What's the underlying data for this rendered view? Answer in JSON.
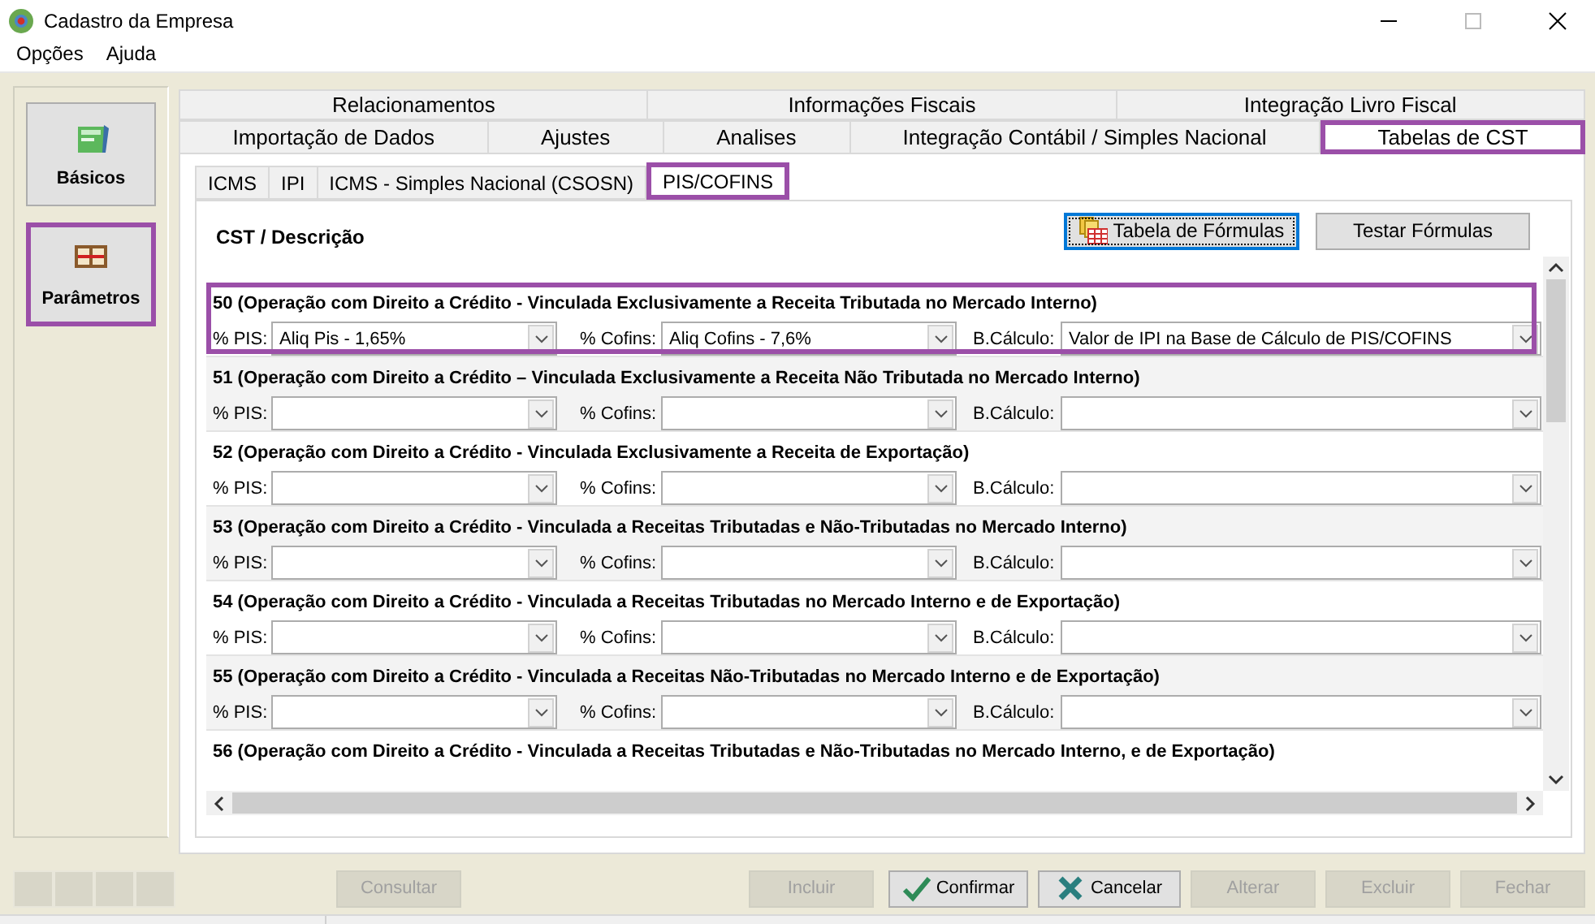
{
  "window": {
    "title": "Cadastro da Empresa"
  },
  "menu": [
    {
      "label": "Opções"
    },
    {
      "label": "Ajuda"
    }
  ],
  "sidebar": {
    "items": [
      {
        "label": "Básicos",
        "highlighted": false
      },
      {
        "label": "Parâmetros",
        "highlighted": true
      }
    ]
  },
  "tab_rows": [
    [
      {
        "label": "Relacionamentos",
        "selected": false,
        "highlighted": false
      },
      {
        "label": "Informações Fiscais",
        "selected": false,
        "highlighted": false
      },
      {
        "label": "Integração Livro Fiscal",
        "selected": false,
        "highlighted": false
      }
    ],
    [
      {
        "label": "Importação de Dados",
        "selected": false,
        "highlighted": false
      },
      {
        "label": "Ajustes",
        "selected": false,
        "highlighted": false
      },
      {
        "label": "Analises",
        "selected": false,
        "highlighted": false
      },
      {
        "label": "Integração Contábil / Simples Nacional",
        "selected": false,
        "highlighted": false
      },
      {
        "label": "Tabelas de CST",
        "selected": true,
        "highlighted": true
      }
    ]
  ],
  "subtabs": [
    {
      "label": "ICMS",
      "selected": false,
      "highlighted": false
    },
    {
      "label": "IPI",
      "selected": false,
      "highlighted": false
    },
    {
      "label": "ICMS - Simples Nacional (CSOSN)",
      "selected": false,
      "highlighted": false
    },
    {
      "label": "PIS/COFINS",
      "selected": true,
      "highlighted": true
    }
  ],
  "header": {
    "title": "CST / Descrição"
  },
  "header_buttons": [
    {
      "label": "Tabela de Fórmulas",
      "focused": true
    },
    {
      "label": "Testar Fórmulas",
      "focused": false
    }
  ],
  "cst_rows": [
    {
      "title": "50 (Operação com Direito a Crédito - Vinculada Exclusivamente a Receita Tributada no Mercado Interno)",
      "highlighted": true,
      "fields": [
        {
          "label": "% PIS:",
          "value": "Aliq Pis - 1,65%"
        },
        {
          "label": "% Cofins:",
          "value": "Aliq Cofins - 7,6%"
        },
        {
          "label": "B.Cálculo:",
          "value": "Valor de IPI na Base de Cálculo de PIS/COFINS"
        }
      ]
    },
    {
      "title": "51 (Operação com Direito a Crédito – Vinculada Exclusivamente a Receita Não Tributada no Mercado Interno)",
      "highlighted": false,
      "fields": [
        {
          "label": "% PIS:"
        },
        {
          "label": "% Cofins:"
        },
        {
          "label": "B.Cálculo:"
        }
      ]
    },
    {
      "title": "52 (Operação com Direito a Crédito - Vinculada Exclusivamente a Receita de Exportação)",
      "highlighted": false,
      "fields": [
        {
          "label": "% PIS:"
        },
        {
          "label": "% Cofins:"
        },
        {
          "label": "B.Cálculo:"
        }
      ]
    },
    {
      "title": "53 (Operação com Direito a Crédito - Vinculada a Receitas Tributadas e Não-Tributadas no Mercado Interno)",
      "highlighted": false,
      "fields": [
        {
          "label": "% PIS:"
        },
        {
          "label": "% Cofins:"
        },
        {
          "label": "B.Cálculo:"
        }
      ]
    },
    {
      "title": "54 (Operação com Direito a Crédito - Vinculada a Receitas Tributadas no Mercado Interno e de Exportação)",
      "highlighted": false,
      "fields": [
        {
          "label": "% PIS:"
        },
        {
          "label": "% Cofins:"
        },
        {
          "label": "B.Cálculo:"
        }
      ]
    },
    {
      "title": "55 (Operação com Direito a Crédito - Vinculada a Receitas Não-Tributadas no Mercado Interno e de Exportação)",
      "highlighted": false,
      "fields": [
        {
          "label": "% PIS:"
        },
        {
          "label": "% Cofins:"
        },
        {
          "label": "B.Cálculo:"
        }
      ]
    },
    {
      "title": "56 (Operação com Direito a Crédito - Vinculada a Receitas Tributadas e Não-Tributadas no Mercado Interno, e de Exportação)",
      "highlighted": false,
      "fields": []
    }
  ],
  "footer_buttons": [
    {
      "label": "Consultar",
      "disabled": true
    },
    {
      "label": "Incluir",
      "disabled": true
    },
    {
      "label": "Confirmar",
      "disabled": false
    },
    {
      "label": "Cancelar",
      "disabled": false
    },
    {
      "label": "Alterar",
      "disabled": true
    },
    {
      "label": "Excluir",
      "disabled": true
    },
    {
      "label": "Fechar",
      "disabled": true
    }
  ]
}
